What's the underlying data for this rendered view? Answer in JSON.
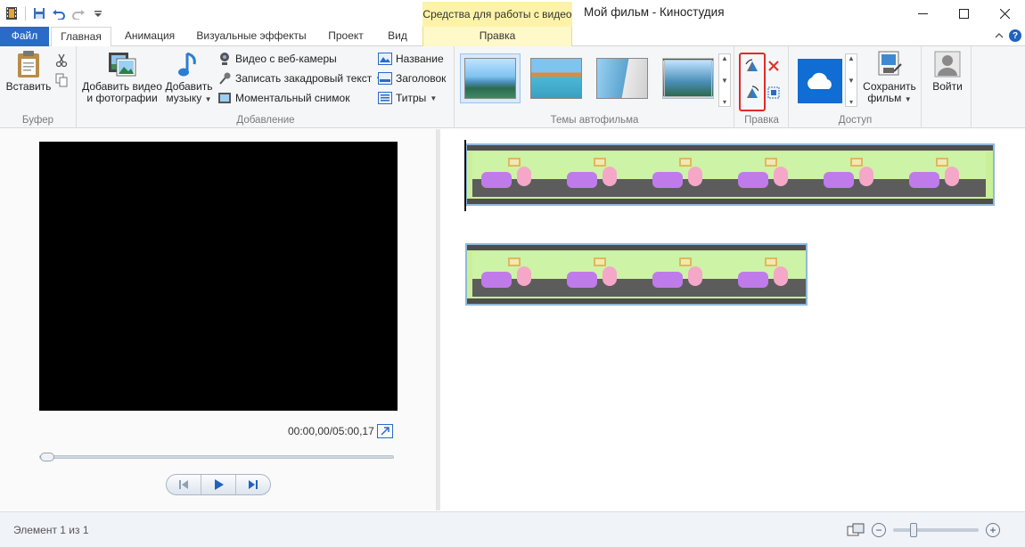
{
  "window": {
    "title": "Мой фильм - Киностудия",
    "context_group": "Средства для работы с видео"
  },
  "tabs": {
    "file": "Файл",
    "items": [
      "Главная",
      "Анимация",
      "Визуальные эффекты",
      "Проект",
      "Вид"
    ],
    "context_tab": "Правка",
    "active": "Главная"
  },
  "ribbon": {
    "clipboard": {
      "label": "Буфер",
      "paste": "Вставить"
    },
    "add": {
      "label": "Добавление",
      "add_video_line1": "Добавить видео",
      "add_video_line2": "и фотографии",
      "add_music_line1": "Добавить",
      "add_music_line2": "музыку",
      "webcam": "Видео с веб-камеры",
      "record_narration": "Записать закадровый текст",
      "snapshot": "Моментальный снимок",
      "title": "Название",
      "caption": "Заголовок",
      "credits": "Титры"
    },
    "themes": {
      "label": "Темы автофильма",
      "selected_index": 0
    },
    "editing": {
      "label": "Правка"
    },
    "share": {
      "label": "Доступ",
      "save_line1": "Сохранить",
      "save_line2": "фильм"
    },
    "signin": "Войти"
  },
  "preview": {
    "timecode": "00:00,00/05:00,17",
    "seek_position": 0
  },
  "statusbar": {
    "text": "Элемент 1 из 1",
    "zoom_level": 0.22
  },
  "colors": {
    "file_tab": "#2a6bc7",
    "context_band": "#fcf3a8",
    "highlight_box": "#e02a2a"
  }
}
